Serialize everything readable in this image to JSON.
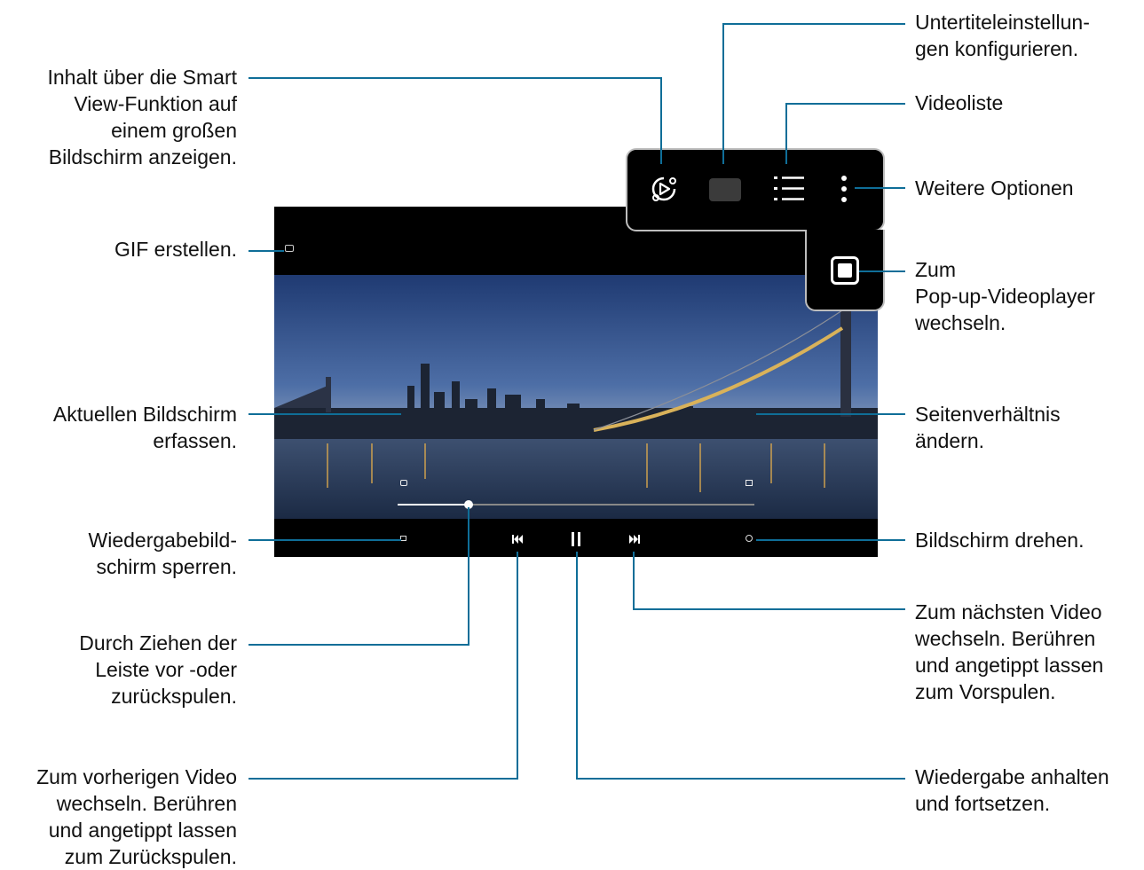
{
  "colors": {
    "leader_line": "#0f6e98",
    "popup_border": "#bdbdbd",
    "label_text": "#111111"
  },
  "callouts": {
    "smart_view": "Inhalt über die Smart\nView-Funktion auf\neinem großen\nBildschirm anzeigen.",
    "gif": "GIF erstellen.",
    "capture": "Aktuellen Bildschirm\nerfassen.",
    "lock": "Wiedergabebild-\nschirm sperren.",
    "seek": "Durch Ziehen der\nLeiste vor -oder\nzurückspulen.",
    "previous": "Zum vorherigen Video\nwechseln. Berühren\nund angetippt lassen\nzum Zurückspulen.",
    "subtitles": "Untertiteleinstellun-\ngen konfigurieren.",
    "video_list": "Videoliste",
    "more_options": "Weitere Optionen",
    "popup_player": "Zum\nPop-up-Videoplayer\nwechseln.",
    "aspect_ratio": "Seitenverhältnis\nändern.",
    "rotate": "Bildschirm drehen.",
    "next": "Zum nächsten Video\nwechseln. Berühren\nund angetippt lassen\nzum Vorspulen.",
    "pause": "Wiedergabe anhalten\nund fortsetzen."
  },
  "player": {
    "title": "",
    "progress": 0.2,
    "icons": [
      "smart-view-icon",
      "subtitles-icon",
      "video-list-icon",
      "more-options-icon",
      "popup-player-icon",
      "gif-icon",
      "capture-icon",
      "aspect-ratio-icon",
      "lock-icon",
      "previous-icon",
      "pause-icon",
      "next-icon",
      "rotate-icon"
    ]
  }
}
